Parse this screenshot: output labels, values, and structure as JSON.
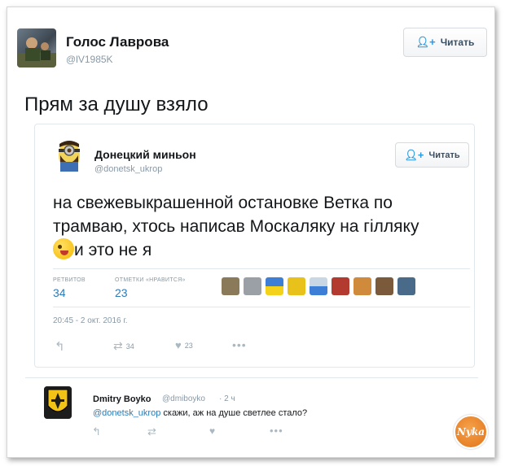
{
  "tweet": {
    "author_name": "Голос Лаврова",
    "author_handle": "@lV1985K",
    "follow_label": "Читать",
    "text": "Прям за душу взяло"
  },
  "quoted": {
    "author_name": "Донецкий миньон",
    "author_handle": "@donetsk_ukrop",
    "follow_label": "Читать",
    "text_line1": "на свежевыкрашенной остановке Ветка по",
    "text_line2": "трамваю, хтось написав Москаляку на гілляку",
    "text_line3": "и это не я",
    "emoji_icon": "winking-tongue-face-icon",
    "retweets_label": "РЕТВИТОВ",
    "retweets_count": "34",
    "likes_label": "ОТМЕТКИ «НРАВИТСЯ»",
    "likes_count": "23",
    "date": "20:45 - 2 окт. 2016 г.",
    "actions": {
      "retweet_count": "34",
      "like_count": "23"
    },
    "liker_colors": [
      "#8a7a5a",
      "#9aa0a6",
      "#3d7fd6",
      "#e8c21a",
      "#5b6f85",
      "#c9d6e3",
      "#b23a2e",
      "#d08a3c",
      "#7a5a3a",
      "#4a6a8a"
    ]
  },
  "reply": {
    "author_name": "Dmitry Boyko",
    "author_handle": "@dmiboyko",
    "time": "· 2 ч",
    "mention": "@donetsk_ukrop",
    "text": " скажи, аж на душе светлее стало?"
  },
  "watermark": {
    "text": "Nyka"
  },
  "colors": {
    "accent": "#2b7bb9",
    "muted": "#8899a6",
    "border": "#e1e8ed"
  }
}
